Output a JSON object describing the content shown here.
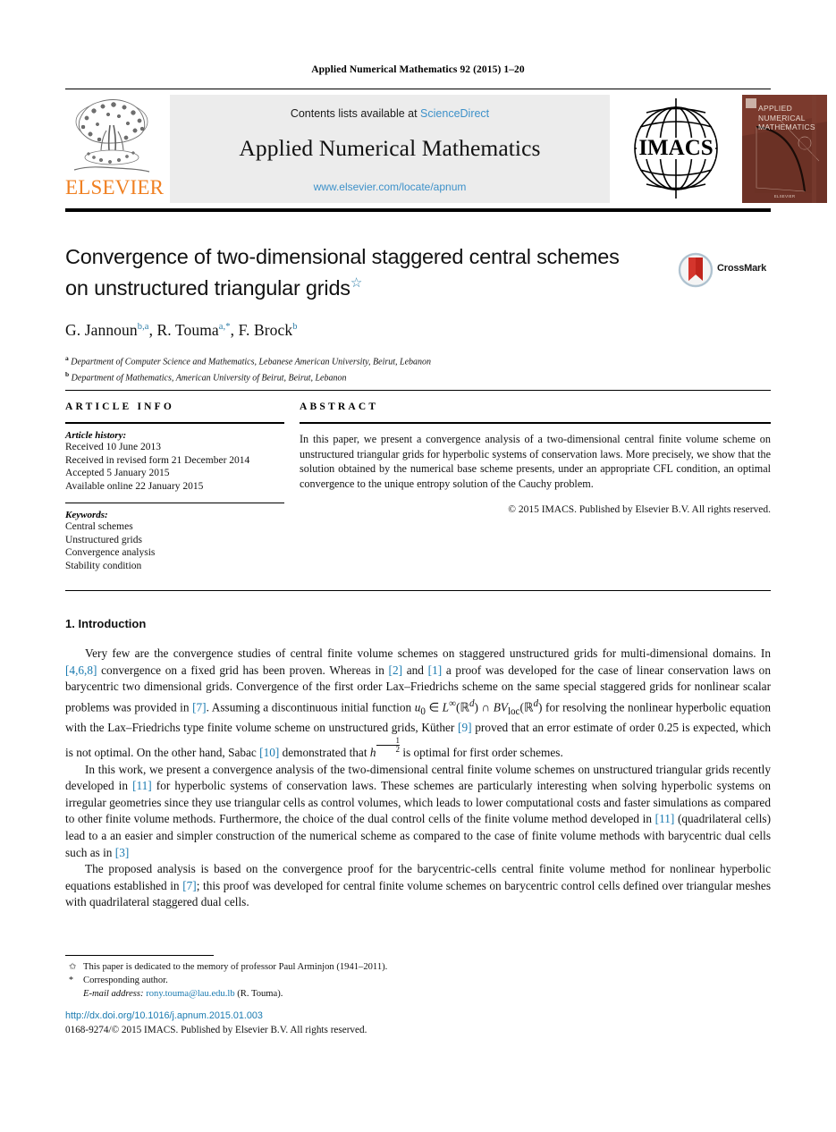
{
  "running_head": "Applied Numerical Mathematics 92 (2015) 1–20",
  "masthead": {
    "elsevier_wordmark": "ELSEVIER",
    "contents_prefix": "Contents lists available at ",
    "sciencedirect": "ScienceDirect",
    "journal_title": "Applied Numerical Mathematics",
    "journal_url": "www.elsevier.com/locate/apnum",
    "imacs_label": "IMACS",
    "cover_title": "APPLIED NUMERICAL MATHEMATICS",
    "cover_publisher": "ELSEVIER"
  },
  "title": {
    "line1": "Convergence of two-dimensional staggered central schemes",
    "line2": "on unstructured triangular grids",
    "dagger": "☆",
    "crossmark_label": "CrossMark"
  },
  "authors": {
    "a1_name": "G. Jannoun",
    "a1_sup": "b,a",
    "a2_name": "R. Touma",
    "a2_sup": "a,*",
    "a3_name": "F. Brock",
    "a3_sup": "b",
    "sep": ", "
  },
  "affiliations": [
    {
      "mark": "a",
      "text": "Department of Computer Science and Mathematics, Lebanese American University, Beirut, Lebanon"
    },
    {
      "mark": "b",
      "text": "Department of Mathematics, American University of Beirut, Beirut, Lebanon"
    }
  ],
  "article_info": {
    "heading": "ARTICLE INFO",
    "history_title": "Article history:",
    "history": [
      "Received 10 June 2013",
      "Received in revised form 21 December 2014",
      "Accepted 5 January 2015",
      "Available online 22 January 2015"
    ],
    "keywords_title": "Keywords:",
    "keywords": [
      "Central schemes",
      "Unstructured grids",
      "Convergence analysis",
      "Stability condition"
    ]
  },
  "abstract": {
    "heading": "ABSTRACT",
    "text": "In this paper, we present a convergence analysis of a two-dimensional central finite volume scheme on unstructured triangular grids for hyperbolic systems of conservation laws. More precisely, we show that the solution obtained by the numerical base scheme presents, under an appropriate CFL condition, an optimal convergence to the unique entropy solution of the Cauchy problem.",
    "copyright": "© 2015 IMACS. Published by Elsevier B.V. All rights reserved."
  },
  "body": {
    "section_heading": "1. Introduction",
    "p1_part1": "Very few are the convergence studies of central finite volume schemes on staggered unstructured grids for multi-dimensional domains. In ",
    "p1_cite1": "[4,6,8]",
    "p1_part2": " convergence on a fixed grid has been proven. Whereas in ",
    "p1_cite2": "[2]",
    "p1_part3": " and ",
    "p1_cite3": "[1]",
    "p1_part4": " a proof was developed for the case of linear conservation laws on barycentric two dimensional grids. Convergence of the first order Lax–Friedrichs scheme on the same special staggered grids for nonlinear scalar problems was provided in ",
    "p1_cite4": "[7]",
    "p1_part5": ". Assuming a discontinuous initial function ",
    "p1_math1": "u",
    "p1_math1_sub": "0",
    "p1_math2": " ∈ ",
    "p1_math3": "L",
    "p1_math3_sup": "∞",
    "p1_math4": "(ℝ",
    "p1_math4_sup": "d",
    "p1_math5": ") ∩ ",
    "p1_math6": "BV",
    "p1_math6_sub": "loc",
    "p1_math7": "(ℝ",
    "p1_math7_sup": "d",
    "p1_math8": ")",
    "p1_part6": " for resolving the nonlinear hyperbolic equation with the Lax–Friedrichs type finite volume scheme on unstructured grids, Küther ",
    "p1_cite5": "[9]",
    "p1_part7": " proved that an error estimate of order 0.25 is expected, which is not optimal. On the other hand, Sabac ",
    "p1_cite6": "[10]",
    "p1_part8": " demonstrated that ",
    "p1_math9": "h",
    "p1_frac_num": "1",
    "p1_frac_den": "2",
    "p1_part9": " is optimal for first order schemes.",
    "p2_part1": "In this work, we present a convergence analysis of the two-dimensional central finite volume schemes on unstructured triangular grids recently developed in ",
    "p2_cite1": "[11]",
    "p2_part2": " for hyperbolic systems of conservation laws. These schemes are particularly interesting when solving hyperbolic systems on irregular geometries since they use triangular cells as control volumes, which leads to lower computational costs and faster simulations as compared to other finite volume methods. Furthermore, the choice of the dual control cells of the finite volume method developed in ",
    "p2_cite2": "[11]",
    "p2_part3": " (quadrilateral cells) lead to a an easier and simpler construction of the numerical scheme as compared to the case of finite volume methods with barycentric dual cells such as in ",
    "p2_cite3": "[3]",
    "p3_part1": "The proposed analysis is based on the convergence proof for the barycentric-cells central finite volume method for nonlinear hyperbolic equations established in ",
    "p3_cite1": "[7]",
    "p3_part2": "; this proof was developed for central finite volume schemes on barycentric control cells defined over triangular meshes with quadrilateral staggered dual cells."
  },
  "footer": {
    "fn1_mark": "✩",
    "fn1_text": "This paper is dedicated to the memory of professor Paul Arminjon (1941–2011).",
    "fn2_mark": "*",
    "fn2_text": "Corresponding author.",
    "email_label": "E-mail address:",
    "email": "rony.touma@lau.edu.lb",
    "email_suffix": " (R. Touma).",
    "doi": "http://dx.doi.org/10.1016/j.apnum.2015.01.003",
    "issn": "0168-9274/© 2015 IMACS. Published by Elsevier B.V. All rights reserved."
  },
  "colors": {
    "link_blue": "#1a7ab0",
    "banner_blue": "#3d91c9",
    "elsevier_orange": "#f08022",
    "cover_brown": "#6d3227",
    "banner_gray": "#ececec"
  }
}
